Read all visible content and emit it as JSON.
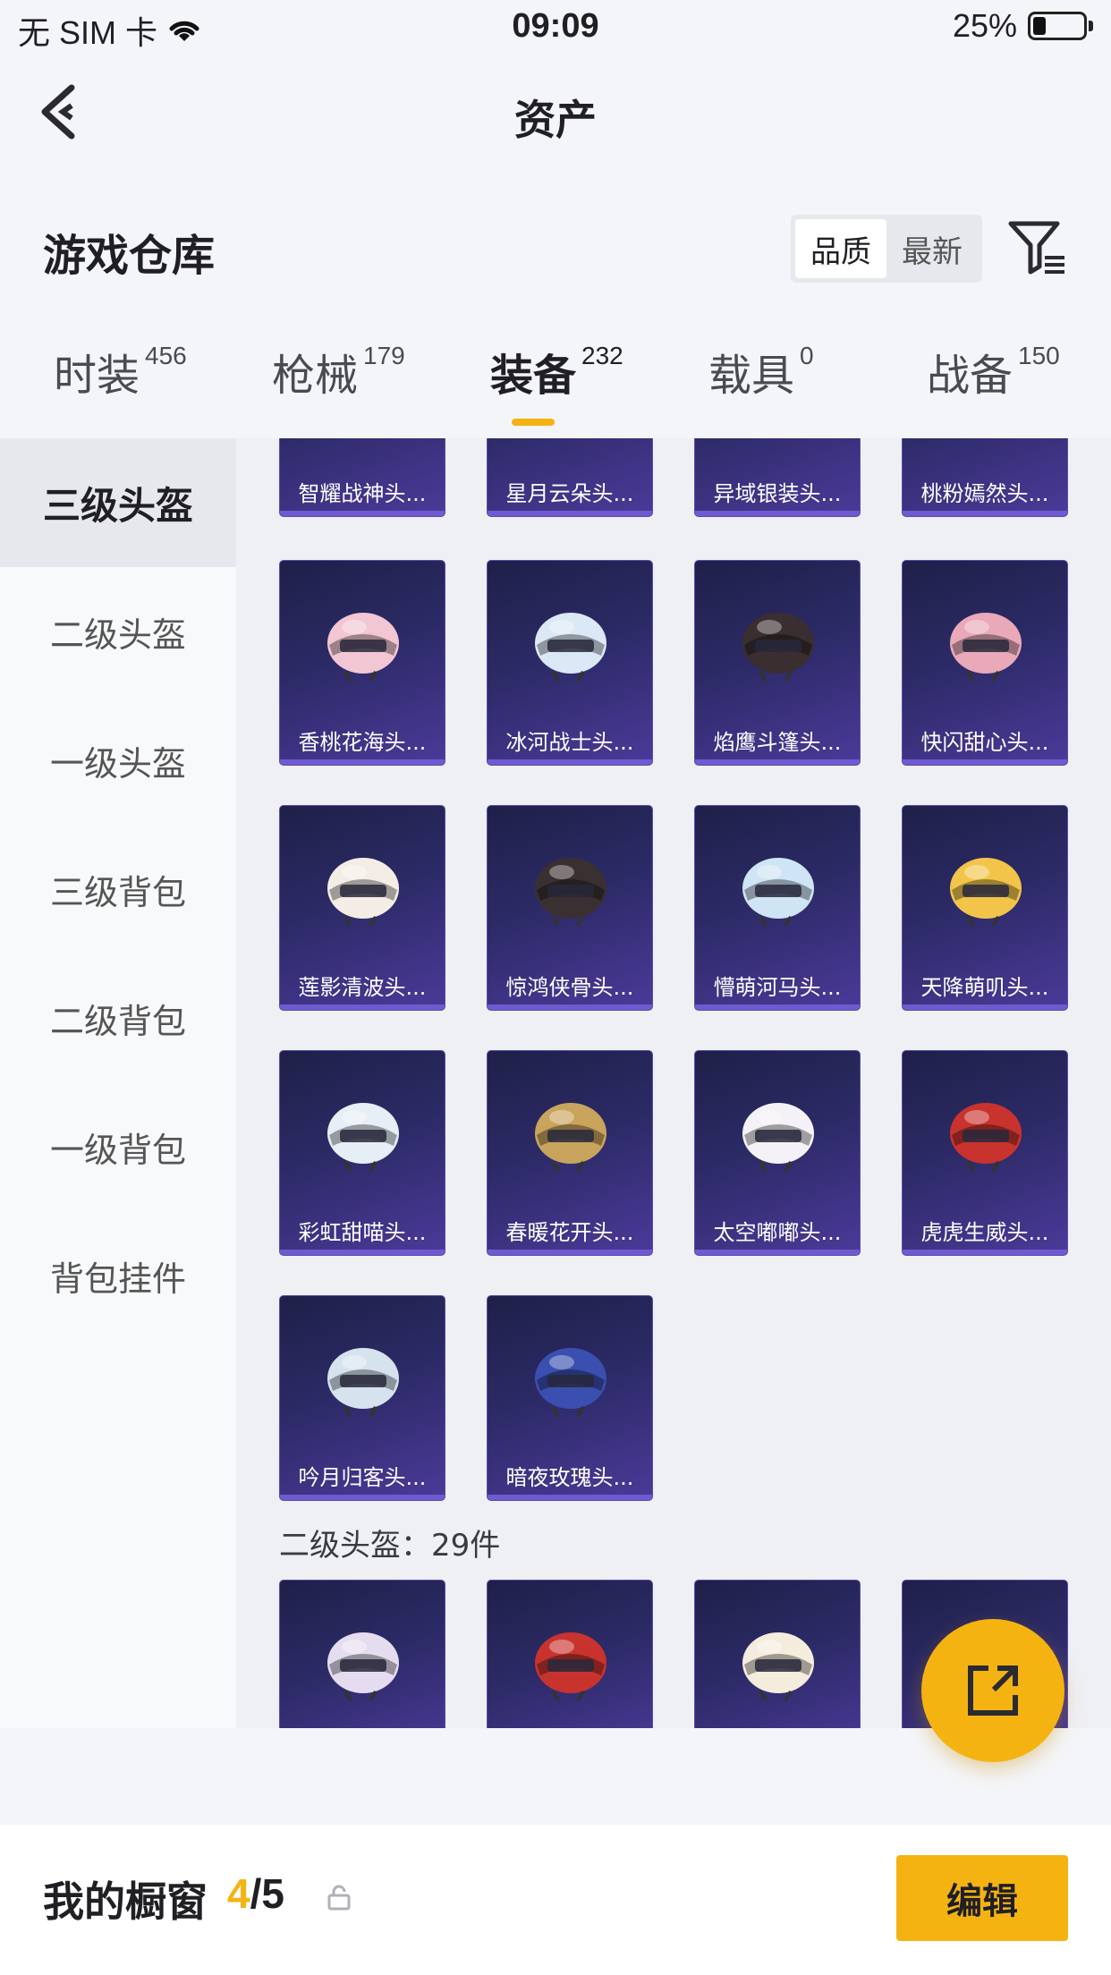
{
  "status_bar": {
    "carrier": "无 SIM 卡",
    "time": "09:09",
    "battery": "25%",
    "battery_level": 0.25
  },
  "nav": {
    "title": "资产"
  },
  "header": {
    "title": "游戏仓库",
    "sort_options": [
      "品质",
      "最新"
    ],
    "sort_selected": "品质"
  },
  "tabs": [
    {
      "label": "时装",
      "count": "456"
    },
    {
      "label": "枪械",
      "count": "179"
    },
    {
      "label": "装备",
      "count": "232"
    },
    {
      "label": "载具",
      "count": "0"
    },
    {
      "label": "战备",
      "count": "150"
    }
  ],
  "active_tab": "装备",
  "sidebar": {
    "items": [
      "三级头盔",
      "二级头盔",
      "一级头盔",
      "三级背包",
      "二级背包",
      "一级背包",
      "背包挂件"
    ],
    "selected": "三级头盔"
  },
  "grid": {
    "top_partial_row": [
      "智耀战神头...",
      "星月云朵头...",
      "异域银装头...",
      "桃粉嫣然头..."
    ],
    "level3_items": [
      {
        "name": "香桃花海头...",
        "color": "#f2c6d2"
      },
      {
        "name": "冰河战士头...",
        "color": "#dbe8f6"
      },
      {
        "name": "焰鹰斗篷头...",
        "color": "#3a2e30"
      },
      {
        "name": "快闪甜心头...",
        "color": "#e9a9b8"
      },
      {
        "name": "莲影清波头...",
        "color": "#f3ede6"
      },
      {
        "name": "惊鸿侠骨头...",
        "color": "#3a3032"
      },
      {
        "name": "懵萌河马头...",
        "color": "#cfe4f4"
      },
      {
        "name": "天降萌叽头...",
        "color": "#f2c54a"
      },
      {
        "name": "彩虹甜喵头...",
        "color": "#e6eef6"
      },
      {
        "name": "春暖花开头...",
        "color": "#c8a45c"
      },
      {
        "name": "太空嘟嘟头...",
        "color": "#f4f2f6"
      },
      {
        "name": "虎虎生威头...",
        "color": "#c8332e"
      },
      {
        "name": "吟月归客头...",
        "color": "#d6e2ee"
      },
      {
        "name": "暗夜玫瑰头...",
        "color": "#3a4fb0"
      }
    ],
    "section2_title": "二级头盔：29件",
    "level2_items": [
      {
        "name": "",
        "color": "#e6dcf0"
      },
      {
        "name": "",
        "color": "#c8332e"
      },
      {
        "name": "",
        "color": "#f4ecdc"
      },
      {
        "name": "",
        "color": "#e8e2ee"
      }
    ]
  },
  "bottom_bar": {
    "title": "我的橱窗",
    "current": "4",
    "total": "/5",
    "edit_label": "编辑"
  },
  "colors": {
    "accent": "#f5b312",
    "card_bg": "#2c2a66"
  }
}
